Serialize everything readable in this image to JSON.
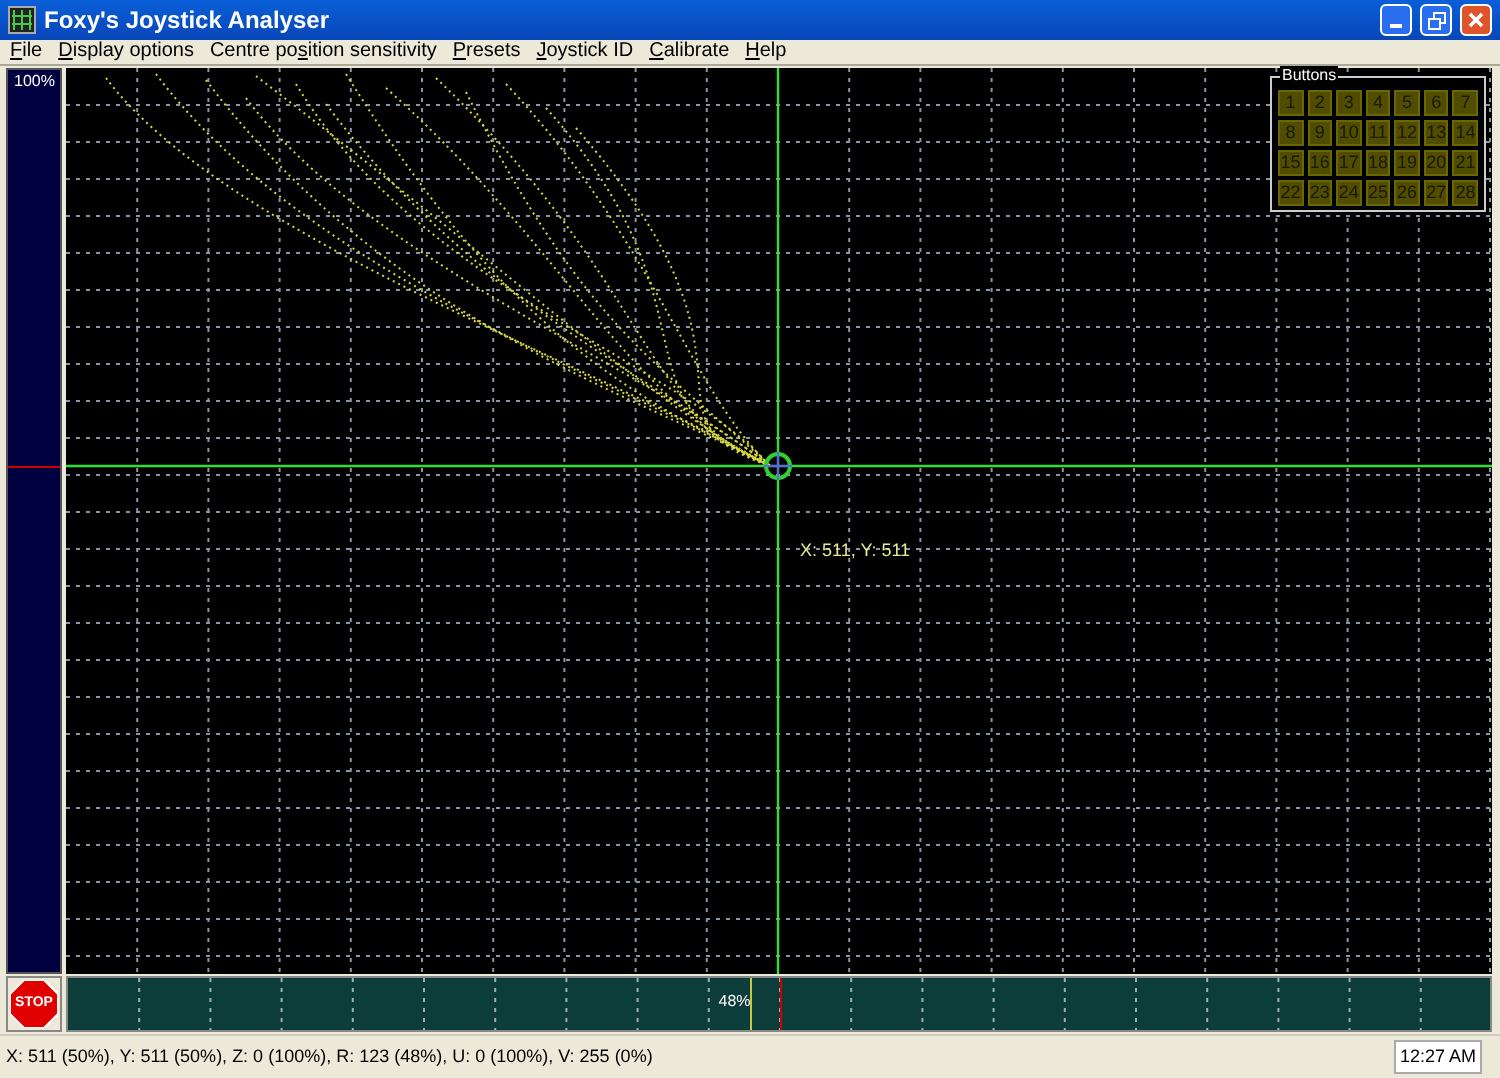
{
  "window": {
    "title": "Foxy's Joystick Analyser"
  },
  "menu": [
    {
      "accel": "F",
      "rest": "ile"
    },
    {
      "accel": "D",
      "rest": "isplay options"
    },
    {
      "lead": "Centre po",
      "accel": "s",
      "rest": "ition sensitivity"
    },
    {
      "accel": "P",
      "rest": "resets"
    },
    {
      "accel": "J",
      "rest": "oystick ID"
    },
    {
      "accel": "C",
      "rest": "alibrate"
    },
    {
      "accel": "H",
      "rest": "elp"
    }
  ],
  "left_meter": {
    "label": "100%",
    "level": 1
  },
  "plot": {
    "cursor_label": "X: 511, Y: 511"
  },
  "buttons_panel": {
    "title": "Buttons",
    "buttons": [
      {
        "label": "1",
        "pressed": false
      },
      {
        "label": "2",
        "pressed": false
      },
      {
        "label": "3",
        "pressed": false
      },
      {
        "label": "4",
        "pressed": false
      },
      {
        "label": "5",
        "pressed": false
      },
      {
        "label": "6",
        "pressed": false
      },
      {
        "label": "7",
        "pressed": false
      },
      {
        "label": "8",
        "pressed": false
      },
      {
        "label": "9",
        "pressed": false
      },
      {
        "label": "10",
        "pressed": false
      },
      {
        "label": "11",
        "pressed": false
      },
      {
        "label": "12",
        "pressed": false
      },
      {
        "label": "13",
        "pressed": false
      },
      {
        "label": "14",
        "pressed": false
      },
      {
        "label": "15",
        "pressed": false
      },
      {
        "label": "16",
        "pressed": false
      },
      {
        "label": "17",
        "pressed": false
      },
      {
        "label": "18",
        "pressed": false
      },
      {
        "label": "19",
        "pressed": false
      },
      {
        "label": "20",
        "pressed": false
      },
      {
        "label": "21",
        "pressed": false
      },
      {
        "label": "22",
        "pressed": false
      },
      {
        "label": "23",
        "pressed": false
      },
      {
        "label": "24",
        "pressed": false
      },
      {
        "label": "25",
        "pressed": false
      },
      {
        "label": "26",
        "pressed": false
      },
      {
        "label": "27",
        "pressed": false
      },
      {
        "label": "28",
        "pressed": false
      }
    ]
  },
  "stop_button": {
    "label": "STOP"
  },
  "bottom_meter": {
    "label": "48%",
    "level": 0.48
  },
  "status_bar": {
    "readout": "X: 511 (50%), Y: 511 (50%), Z: 0 (100%), R: 123 (48%), U: 0 (100%), V: 255 (0%)",
    "time": "12:27 AM"
  }
}
